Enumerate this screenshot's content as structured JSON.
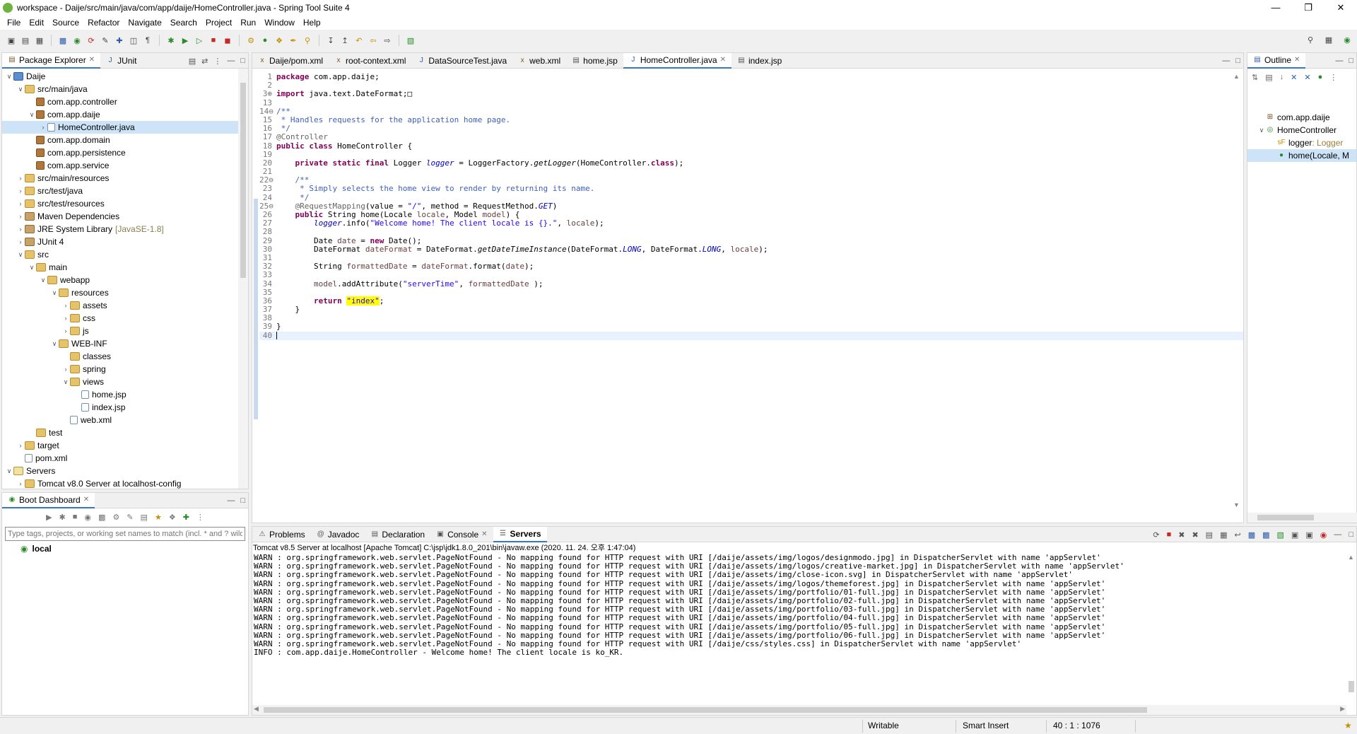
{
  "window": {
    "title": "workspace - Daije/src/main/java/com/app/daije/HomeController.java - Spring Tool Suite 4"
  },
  "menu": [
    "File",
    "Edit",
    "Source",
    "Refactor",
    "Navigate",
    "Search",
    "Project",
    "Run",
    "Window",
    "Help"
  ],
  "left_tabs": {
    "package_explorer": "Package Explorer",
    "junit": "JUnit"
  },
  "tree": [
    {
      "label": "Daije",
      "icon": "proj",
      "tw": "v",
      "indent": 0
    },
    {
      "label": "src/main/java",
      "icon": "folder",
      "tw": "v",
      "indent": 1
    },
    {
      "label": "com.app.controller",
      "icon": "pkg",
      "tw": "",
      "indent": 2
    },
    {
      "label": "com.app.daije",
      "icon": "pkg",
      "tw": "v",
      "indent": 2
    },
    {
      "label": "HomeController.java",
      "icon": "file",
      "tw": ">",
      "indent": 3,
      "selected": true
    },
    {
      "label": "com.app.domain",
      "icon": "pkg",
      "tw": "",
      "indent": 2
    },
    {
      "label": "com.app.persistence",
      "icon": "pkg",
      "tw": "",
      "indent": 2
    },
    {
      "label": "com.app.service",
      "icon": "pkg",
      "tw": "",
      "indent": 2
    },
    {
      "label": "src/main/resources",
      "icon": "folder",
      "tw": ">",
      "indent": 1
    },
    {
      "label": "src/test/java",
      "icon": "folder",
      "tw": ">",
      "indent": 1
    },
    {
      "label": "src/test/resources",
      "icon": "folder",
      "tw": ">",
      "indent": 1
    },
    {
      "label": "Maven Dependencies",
      "icon": "jar",
      "tw": ">",
      "indent": 1
    },
    {
      "label": "JRE System Library",
      "extra": "[JavaSE-1.8]",
      "icon": "jar",
      "tw": ">",
      "indent": 1
    },
    {
      "label": "JUnit 4",
      "icon": "jar",
      "tw": ">",
      "indent": 1
    },
    {
      "label": "src",
      "icon": "folder",
      "tw": "v",
      "indent": 1
    },
    {
      "label": "main",
      "icon": "folder",
      "tw": "v",
      "indent": 2
    },
    {
      "label": "webapp",
      "icon": "folder",
      "tw": "v",
      "indent": 3
    },
    {
      "label": "resources",
      "icon": "folder",
      "tw": "v",
      "indent": 4
    },
    {
      "label": "assets",
      "icon": "folder",
      "tw": ">",
      "indent": 5
    },
    {
      "label": "css",
      "icon": "folder",
      "tw": ">",
      "indent": 5
    },
    {
      "label": "js",
      "icon": "folder",
      "tw": ">",
      "indent": 5
    },
    {
      "label": "WEB-INF",
      "icon": "folder",
      "tw": "v",
      "indent": 4
    },
    {
      "label": "classes",
      "icon": "folder",
      "tw": "",
      "indent": 5
    },
    {
      "label": "spring",
      "icon": "folder",
      "tw": ">",
      "indent": 5
    },
    {
      "label": "views",
      "icon": "folder",
      "tw": "v",
      "indent": 5
    },
    {
      "label": "home.jsp",
      "icon": "file",
      "tw": "",
      "indent": 6
    },
    {
      "label": "index.jsp",
      "icon": "file",
      "tw": "",
      "indent": 6
    },
    {
      "label": "web.xml",
      "icon": "file",
      "tw": "",
      "indent": 5
    },
    {
      "label": "test",
      "icon": "folder",
      "tw": "",
      "indent": 2
    },
    {
      "label": "target",
      "icon": "folder",
      "tw": ">",
      "indent": 1
    },
    {
      "label": "pom.xml",
      "icon": "file",
      "tw": "",
      "indent": 1
    },
    {
      "label": "Servers",
      "icon": "srv",
      "tw": "v",
      "indent": 0
    },
    {
      "label": "Tomcat v8.0 Server at localhost-config",
      "icon": "folder",
      "tw": ">",
      "indent": 1
    }
  ],
  "boot_dashboard": {
    "tab": "Boot Dashboard",
    "filter_placeholder": "Type tags, projects, or working set names to match (incl. * and ? wildcards)",
    "items": [
      "local"
    ]
  },
  "editor_tabs": [
    "Daije/pom.xml",
    "root-context.xml",
    "DataSourceTest.java",
    "web.xml",
    "home.jsp",
    "HomeController.java",
    "index.jsp"
  ],
  "editor_active_tab": "HomeController.java",
  "code": [
    {
      "n": "1",
      "html": "<span class='kw'>package</span> com.app.daije;"
    },
    {
      "n": "2",
      "html": ""
    },
    {
      "n": "3",
      "mark": "+",
      "html": "<span class='kw'>import</span> java.text.DateFormat;&#9633;"
    },
    {
      "n": "13",
      "html": ""
    },
    {
      "n": "14",
      "mark": "-",
      "html": "<span class='cm'>/**</span>"
    },
    {
      "n": "15",
      "html": "<span class='cm'> * Handles requests for the application home page.</span>"
    },
    {
      "n": "16",
      "html": "<span class='cm'> */</span>"
    },
    {
      "n": "17",
      "html": "<span class='an'>@Controller</span>"
    },
    {
      "n": "18",
      "html": "<span class='kw'>public class</span> HomeController {"
    },
    {
      "n": "19",
      "html": ""
    },
    {
      "n": "20",
      "html": "    <span class='kw'>private static final</span> Logger <span class='fd'>logger</span> = LoggerFactory.<span class='it'>getLogger</span>(HomeController.<span class='kw'>class</span>);"
    },
    {
      "n": "21",
      "html": ""
    },
    {
      "n": "22",
      "mark": "-",
      "html": "    <span class='cm'>/**</span>"
    },
    {
      "n": "23",
      "html": "<span class='cm'>     * Simply selects the home view to render by returning its name.</span>"
    },
    {
      "n": "24",
      "html": "<span class='cm'>     */</span>"
    },
    {
      "n": "25",
      "mark": "-",
      "html": "    <span class='an'>@RequestMapping</span>(value = <span class='st'>\"/\"</span>, method = RequestMethod.<span class='fd'>GET</span>)"
    },
    {
      "n": "26",
      "html": "    <span class='kw'>public</span> String home(Locale <span style='color:#6a3e3e'>locale</span>, Model <span style='color:#6a3e3e'>model</span>) {"
    },
    {
      "n": "27",
      "html": "        <span class='fd'>logger</span>.info(<span class='st'>\"Welcome home! The client locale is {}.\"</span>, <span style='color:#6a3e3e'>locale</span>);"
    },
    {
      "n": "28",
      "html": ""
    },
    {
      "n": "29",
      "html": "        Date <span style='color:#6a3e3e'>date</span> = <span class='kw'>new</span> Date();"
    },
    {
      "n": "30",
      "html": "        DateFormat <span style='color:#6a3e3e'>dateFormat</span> = DateFormat.<span class='it'>getDateTimeInstance</span>(DateFormat.<span class='fd'>LONG</span>, DateFormat.<span class='fd'>LONG</span>, <span style='color:#6a3e3e'>locale</span>);"
    },
    {
      "n": "31",
      "html": ""
    },
    {
      "n": "32",
      "html": "        String <span style='color:#6a3e3e'>formattedDate</span> = <span style='color:#6a3e3e'>dateFormat</span>.format(<span style='color:#6a3e3e'>date</span>);"
    },
    {
      "n": "33",
      "html": ""
    },
    {
      "n": "34",
      "html": "        <span style='color:#6a3e3e'>model</span>.addAttribute(<span class='st'>\"serverTime\"</span>, <span style='color:#6a3e3e'>formattedDate</span> );"
    },
    {
      "n": "35",
      "html": ""
    },
    {
      "n": "36",
      "html": "        <span class='kw'>return</span> <span class='st hl'>\"index\"</span>;"
    },
    {
      "n": "37",
      "html": "    }"
    },
    {
      "n": "38",
      "html": ""
    },
    {
      "n": "39",
      "html": "}"
    },
    {
      "n": "40",
      "html": "",
      "current": true
    }
  ],
  "outline": {
    "tab": "Outline",
    "items": [
      {
        "label": "com.app.daije",
        "indent": 0,
        "tw": ""
      },
      {
        "label": "HomeController",
        "indent": 0,
        "tw": "v"
      },
      {
        "label": "logger",
        "suffix": " : Logger",
        "indent": 1,
        "tw": ""
      },
      {
        "label": "home(Locale, M",
        "indent": 1,
        "tw": "",
        "selected": true
      }
    ]
  },
  "bottom_tabs": [
    "Problems",
    "Javadoc",
    "Declaration",
    "Console",
    "Servers"
  ],
  "console": {
    "header": "Tomcat v8.5 Server at localhost [Apache Tomcat] C:\\jsp\\jdk1.8.0_201\\bin\\javaw.exe  (2020. 11. 24. 오후 1:47:04)",
    "lines": [
      "WARN : org.springframework.web.servlet.PageNotFound - No mapping found for HTTP request with URI [/daije/assets/img/logos/designmodo.jpg] in DispatcherServlet with name 'appServlet'",
      "WARN : org.springframework.web.servlet.PageNotFound - No mapping found for HTTP request with URI [/daije/assets/img/logos/creative-market.jpg] in DispatcherServlet with name 'appServlet'",
      "WARN : org.springframework.web.servlet.PageNotFound - No mapping found for HTTP request with URI [/daije/assets/img/close-icon.svg] in DispatcherServlet with name 'appServlet'",
      "WARN : org.springframework.web.servlet.PageNotFound - No mapping found for HTTP request with URI [/daije/assets/img/logos/themeforest.jpg] in DispatcherServlet with name 'appServlet'",
      "WARN : org.springframework.web.servlet.PageNotFound - No mapping found for HTTP request with URI [/daije/assets/img/portfolio/01-full.jpg] in DispatcherServlet with name 'appServlet'",
      "WARN : org.springframework.web.servlet.PageNotFound - No mapping found for HTTP request with URI [/daije/assets/img/portfolio/02-full.jpg] in DispatcherServlet with name 'appServlet'",
      "WARN : org.springframework.web.servlet.PageNotFound - No mapping found for HTTP request with URI [/daije/assets/img/portfolio/03-full.jpg] in DispatcherServlet with name 'appServlet'",
      "WARN : org.springframework.web.servlet.PageNotFound - No mapping found for HTTP request with URI [/daije/assets/img/portfolio/04-full.jpg] in DispatcherServlet with name 'appServlet'",
      "WARN : org.springframework.web.servlet.PageNotFound - No mapping found for HTTP request with URI [/daije/assets/img/portfolio/05-full.jpg] in DispatcherServlet with name 'appServlet'",
      "WARN : org.springframework.web.servlet.PageNotFound - No mapping found for HTTP request with URI [/daije/assets/img/portfolio/06-full.jpg] in DispatcherServlet with name 'appServlet'",
      "WARN : org.springframework.web.servlet.PageNotFound - No mapping found for HTTP request with URI [/daije/css/styles.css] in DispatcherServlet with name 'appServlet'",
      "INFO : com.app.daije.HomeController - Welcome home! The client locale is ko_KR."
    ]
  },
  "status": {
    "writable": "Writable",
    "insert_mode": "Smart Insert",
    "position": "40 : 1 : 1076"
  }
}
